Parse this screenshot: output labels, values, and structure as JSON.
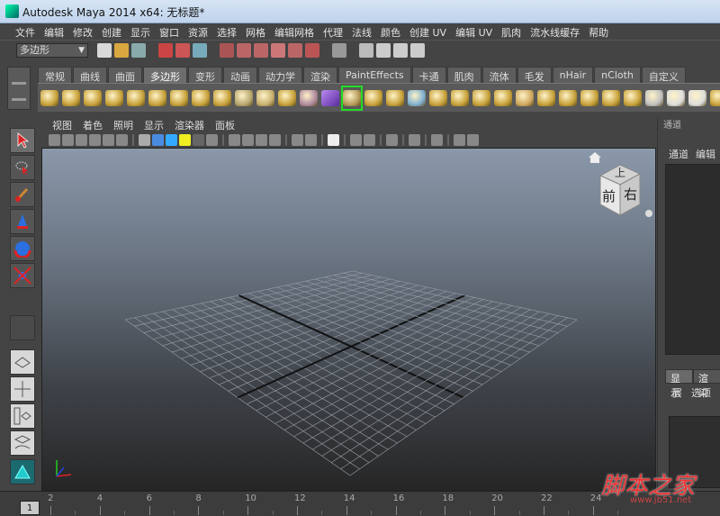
{
  "window": {
    "title": "Autodesk Maya 2014 x64: 无标题*"
  },
  "menubar": {
    "items": [
      "文件",
      "编辑",
      "修改",
      "创建",
      "显示",
      "窗口",
      "资源",
      "选择",
      "网格",
      "编辑网格",
      "代理",
      "法线",
      "颜色",
      "创建 UV",
      "编辑 UV",
      "肌肉",
      "流水线缓存",
      "帮助"
    ]
  },
  "statusline": {
    "mode": "多边形"
  },
  "shelf": {
    "tabs": [
      "常规",
      "曲线",
      "曲面",
      "多边形",
      "变形",
      "动画",
      "动力学",
      "渲染",
      "PaintEffects",
      "卡通",
      "肌肉",
      "流体",
      "毛发",
      "nHair",
      "nCloth",
      "自定义"
    ],
    "active_tab": "多边形"
  },
  "panel": {
    "menu": [
      "视图",
      "着色",
      "照明",
      "显示",
      "渲染器",
      "面板"
    ]
  },
  "viewcube": {
    "front": "前",
    "right": "右",
    "top": "上"
  },
  "right_panel": {
    "header": "通道",
    "tabs": [
      "通道",
      "编辑"
    ],
    "layer_tabs": [
      "显示",
      "渲染"
    ],
    "layer_menu": [
      "层",
      "选项"
    ]
  },
  "timeslider": {
    "current_frame": "1",
    "ticks": [
      "2",
      "4",
      "6",
      "8",
      "10",
      "12",
      "14",
      "16",
      "18",
      "20",
      "22",
      "24"
    ]
  },
  "watermark": {
    "text": "脚本之家",
    "url": "www.jb51.net"
  },
  "colors": {
    "accent": "#2aa",
    "viewport_top": "#8a98aa",
    "viewport_bottom": "#262626"
  }
}
